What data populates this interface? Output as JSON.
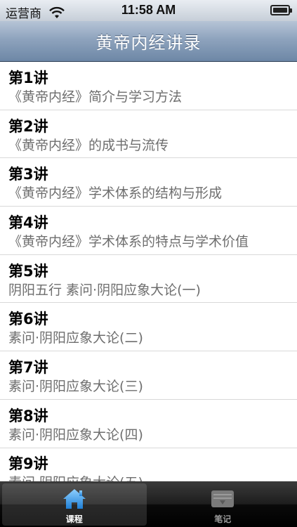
{
  "status_bar": {
    "carrier": "运营商",
    "time": "11:58 AM",
    "wifi_icon": "wifi-icon",
    "battery_icon": "battery-icon"
  },
  "nav": {
    "title": "黄帝内经讲录"
  },
  "lectures": [
    {
      "number": "第1讲",
      "subtitle": "《黄帝内经》简介与学习方法"
    },
    {
      "number": "第2讲",
      "subtitle": "《黄帝内经》的成书与流传"
    },
    {
      "number": "第3讲",
      "subtitle": "《黄帝内经》学术体系的结构与形成"
    },
    {
      "number": "第4讲",
      "subtitle": "《黄帝内经》学术体系的特点与学术价值"
    },
    {
      "number": "第5讲",
      "subtitle": "阴阳五行 素问·阴阳应象大论(一)"
    },
    {
      "number": "第6讲",
      "subtitle": "素问·阴阳应象大论(二)"
    },
    {
      "number": "第7讲",
      "subtitle": "素问·阴阳应象大论(三)"
    },
    {
      "number": "第8讲",
      "subtitle": "素问·阴阳应象大论(四)"
    },
    {
      "number": "第9讲",
      "subtitle": "素问·阴阳应象大论(五)"
    }
  ],
  "tabs": [
    {
      "label": "课程",
      "icon": "home-icon",
      "active": true
    },
    {
      "label": "笔记",
      "icon": "notebook-icon",
      "active": false
    }
  ]
}
